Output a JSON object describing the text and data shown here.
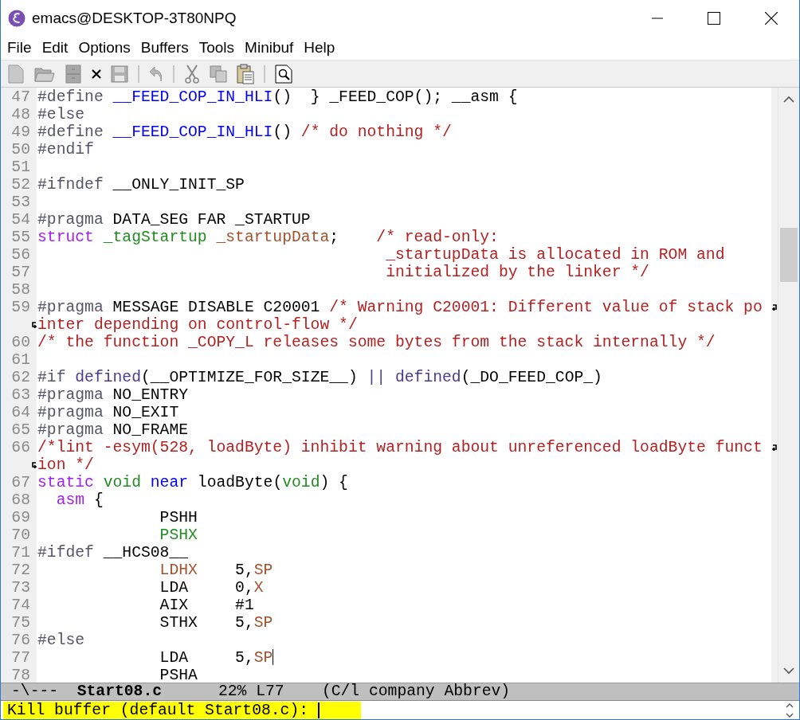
{
  "window": {
    "title": "emacs@DESKTOP-3T80NPQ"
  },
  "menu": [
    "File",
    "Edit",
    "Options",
    "Buffers",
    "Tools",
    "Minibuf",
    "Help"
  ],
  "toolbar": [
    {
      "kind": "new"
    },
    {
      "kind": "open"
    },
    {
      "kind": "cabinet"
    },
    {
      "kind": "close"
    },
    {
      "kind": "save"
    },
    {
      "kind": "separator"
    },
    {
      "kind": "undo"
    },
    {
      "kind": "separator"
    },
    {
      "kind": "cut"
    },
    {
      "kind": "copy"
    },
    {
      "kind": "paste"
    },
    {
      "kind": "separator"
    },
    {
      "kind": "search"
    }
  ],
  "lines": [
    {
      "kind": "line",
      "number": "47",
      "tokens": [
        {
          "kind": "preprocessor",
          "text": "#define "
        },
        {
          "kind": "function",
          "text": "__FEED_COP_IN_HLI"
        },
        {
          "kind": "plain",
          "text": "()  } _FEED_COP(); __asm {"
        }
      ]
    },
    {
      "kind": "line",
      "number": "48",
      "tokens": [
        {
          "kind": "preprocessor",
          "text": "#else"
        }
      ]
    },
    {
      "kind": "line",
      "number": "49",
      "tokens": [
        {
          "kind": "preprocessor",
          "text": "#define "
        },
        {
          "kind": "function",
          "text": "__FEED_COP_IN_HLI"
        },
        {
          "kind": "plain",
          "text": "() "
        },
        {
          "kind": "comment",
          "text": "/* do nothing */"
        }
      ]
    },
    {
      "kind": "line",
      "number": "50",
      "tokens": [
        {
          "kind": "preprocessor",
          "text": "#endif"
        }
      ]
    },
    {
      "kind": "line",
      "number": "51"
    },
    {
      "kind": "line",
      "number": "52",
      "tokens": [
        {
          "kind": "preprocessor",
          "text": "#ifndef "
        },
        {
          "kind": "plain",
          "text": "__ONLY_INIT_SP"
        }
      ]
    },
    {
      "kind": "line",
      "number": "53"
    },
    {
      "kind": "line",
      "number": "54",
      "tokens": [
        {
          "kind": "preprocessor",
          "text": "#pragma "
        },
        {
          "kind": "plain",
          "text": "DATA_SEG FAR _STARTUP"
        }
      ]
    },
    {
      "kind": "line",
      "number": "55",
      "tokens": [
        {
          "kind": "keyword",
          "text": "struct"
        },
        {
          "kind": "type",
          "text": " _tagStartup"
        },
        {
          "kind": "variable",
          "text": " _startupData"
        },
        {
          "kind": "plain",
          "text": ";    "
        },
        {
          "kind": "comment",
          "text": "/* read-only:"
        }
      ]
    },
    {
      "kind": "line",
      "number": "56",
      "tokens": [
        {
          "kind": "comment",
          "text": "                                     _startupData is allocated in ROM and"
        }
      ]
    },
    {
      "kind": "line",
      "number": "57",
      "tokens": [
        {
          "kind": "comment",
          "text": "                                     initialized by the linker */"
        }
      ]
    },
    {
      "kind": "line",
      "number": "58"
    },
    {
      "kind": "line",
      "number": "59",
      "tokens": [
        {
          "kind": "preprocessor",
          "text": "#pragma "
        },
        {
          "kind": "plain",
          "text": "MESSAGE DISABLE C20001 "
        },
        {
          "kind": "comment",
          "text": "/* Warning C20001: Different value of stack po"
        }
      ]
    },
    {
      "kind": "continued",
      "tokens": [
        {
          "kind": "comment",
          "text": "inter depending on control-flow */"
        }
      ]
    },
    {
      "kind": "line",
      "number": "60",
      "tokens": [
        {
          "kind": "comment",
          "text": "/* the function _COPY_L releases some bytes from the stack internally */"
        }
      ]
    },
    {
      "kind": "line",
      "number": "61"
    },
    {
      "kind": "line",
      "number": "62",
      "tokens": [
        {
          "kind": "preprocessor",
          "text": "#if "
        },
        {
          "kind": "builtin",
          "text": "defined"
        },
        {
          "kind": "plain",
          "text": "(__OPTIMIZE_FOR_SIZE__) "
        },
        {
          "kind": "builtin",
          "text": "||"
        },
        {
          "kind": "builtin",
          "text": " defined"
        },
        {
          "kind": "plain",
          "text": "(_DO_FEED_COP_)"
        }
      ]
    },
    {
      "kind": "line",
      "number": "63",
      "tokens": [
        {
          "kind": "preprocessor",
          "text": "#pragma "
        },
        {
          "kind": "plain",
          "text": "NO_ENTRY"
        }
      ]
    },
    {
      "kind": "line",
      "number": "64",
      "tokens": [
        {
          "kind": "preprocessor",
          "text": "#pragma "
        },
        {
          "kind": "plain",
          "text": "NO_EXIT"
        }
      ]
    },
    {
      "kind": "line",
      "number": "65",
      "tokens": [
        {
          "kind": "preprocessor",
          "text": "#pragma "
        },
        {
          "kind": "plain",
          "text": "NO_FRAME"
        }
      ]
    },
    {
      "kind": "line",
      "number": "66",
      "tokens": [
        {
          "kind": "comment",
          "text": "/*lint -esym(528, loadByte) inhibit warning about unreferenced loadByte funct"
        }
      ]
    },
    {
      "kind": "continued",
      "tokens": [
        {
          "kind": "comment",
          "text": "ion */"
        }
      ]
    },
    {
      "kind": "line",
      "number": "67",
      "tokens": [
        {
          "kind": "keyword",
          "text": "static"
        },
        {
          "kind": "type",
          "text": " void"
        },
        {
          "kind": "function",
          "text": " near"
        },
        {
          "kind": "plain",
          "text": " loadByte("
        },
        {
          "kind": "type",
          "text": "void"
        },
        {
          "kind": "plain",
          "text": ") {"
        }
      ]
    },
    {
      "kind": "line",
      "number": "68",
      "tokens": [
        {
          "kind": "keyword",
          "text": "  asm"
        },
        {
          "kind": "plain",
          "text": " {"
        }
      ]
    },
    {
      "kind": "line",
      "number": "69",
      "tokens": [
        {
          "kind": "plain",
          "text": "             PSHH"
        }
      ]
    },
    {
      "kind": "line",
      "number": "70",
      "tokens": [
        {
          "kind": "type",
          "text": "             PSHX"
        }
      ]
    },
    {
      "kind": "line",
      "number": "71",
      "tokens": [
        {
          "kind": "preprocessor",
          "text": "#ifdef "
        },
        {
          "kind": "plain",
          "text": "__HCS08__"
        }
      ]
    },
    {
      "kind": "line",
      "number": "72",
      "tokens": [
        {
          "kind": "variable",
          "text": "             LDHX"
        },
        {
          "kind": "plain",
          "text": "    5,"
        },
        {
          "kind": "variable",
          "text": "SP"
        }
      ]
    },
    {
      "kind": "line",
      "number": "73",
      "tokens": [
        {
          "kind": "plain",
          "text": "             LDA     0,"
        },
        {
          "kind": "variable",
          "text": "X"
        }
      ]
    },
    {
      "kind": "line",
      "number": "74",
      "tokens": [
        {
          "kind": "plain",
          "text": "             AIX     #1"
        }
      ]
    },
    {
      "kind": "line",
      "number": "75",
      "tokens": [
        {
          "kind": "plain",
          "text": "             STHX    5,"
        },
        {
          "kind": "variable",
          "text": "SP"
        }
      ]
    },
    {
      "kind": "line",
      "number": "76",
      "tokens": [
        {
          "kind": "preprocessor",
          "text": "#else"
        }
      ]
    },
    {
      "kind": "line",
      "number": "77",
      "cursor": true,
      "tokens": [
        {
          "kind": "plain",
          "text": "             LDA     5,"
        },
        {
          "kind": "variable",
          "text": "SP"
        }
      ]
    },
    {
      "kind": "line",
      "number": "78",
      "tokens": [
        {
          "kind": "plain",
          "text": "             PSHA"
        }
      ]
    }
  ],
  "mode_line": {
    "status": "-\\---",
    "buffer": "Start08.c",
    "position": "22% L77",
    "modes": "(C/l company Abbrev)"
  },
  "minibuffer": {
    "prompt": "Kill buffer (default Start08.c):",
    "highlighted": true
  }
}
